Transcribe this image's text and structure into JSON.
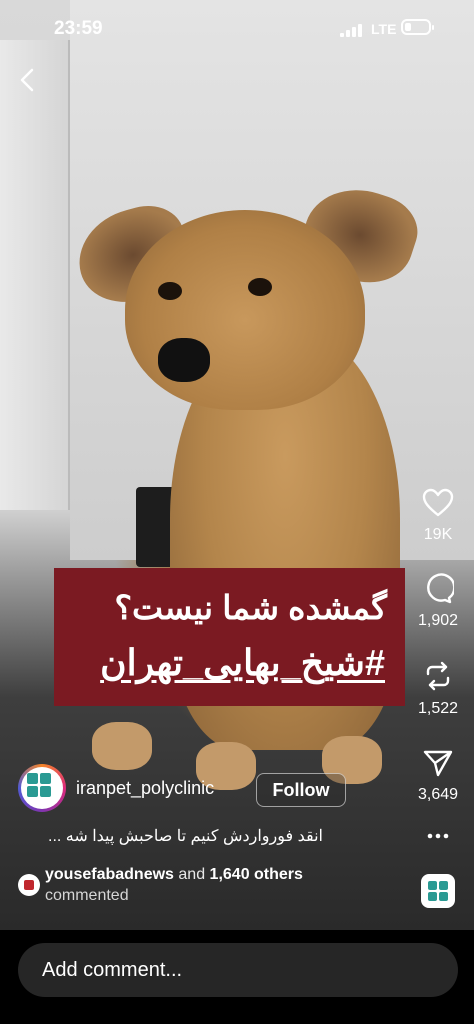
{
  "status_bar": {
    "time": "23:59",
    "network": "LTE"
  },
  "reel": {
    "overlay_text": {
      "line1": "گمشده شما نیست؟",
      "line2": "#شیخ_بهایی_تهران"
    },
    "overlay_color": "#7b1a22",
    "author": {
      "username": "iranpet_polyclinic",
      "follow_label": "Follow"
    },
    "caption": "انقد فورواردش کنیم تا صاحبش پیدا شه ...",
    "commented": {
      "user": "yousefabadnews",
      "and_text": "and",
      "others": "1,640 others",
      "action": "commented"
    }
  },
  "actions": {
    "likes": "19K",
    "comments": "1,902",
    "reposts": "1,522",
    "shares": "3,649"
  },
  "comment_bar": {
    "placeholder": "Add comment..."
  },
  "icons": [
    "back-icon",
    "heart-icon",
    "comment-icon",
    "repost-icon",
    "send-icon",
    "more-icon",
    "audio-thumbnail-icon"
  ]
}
